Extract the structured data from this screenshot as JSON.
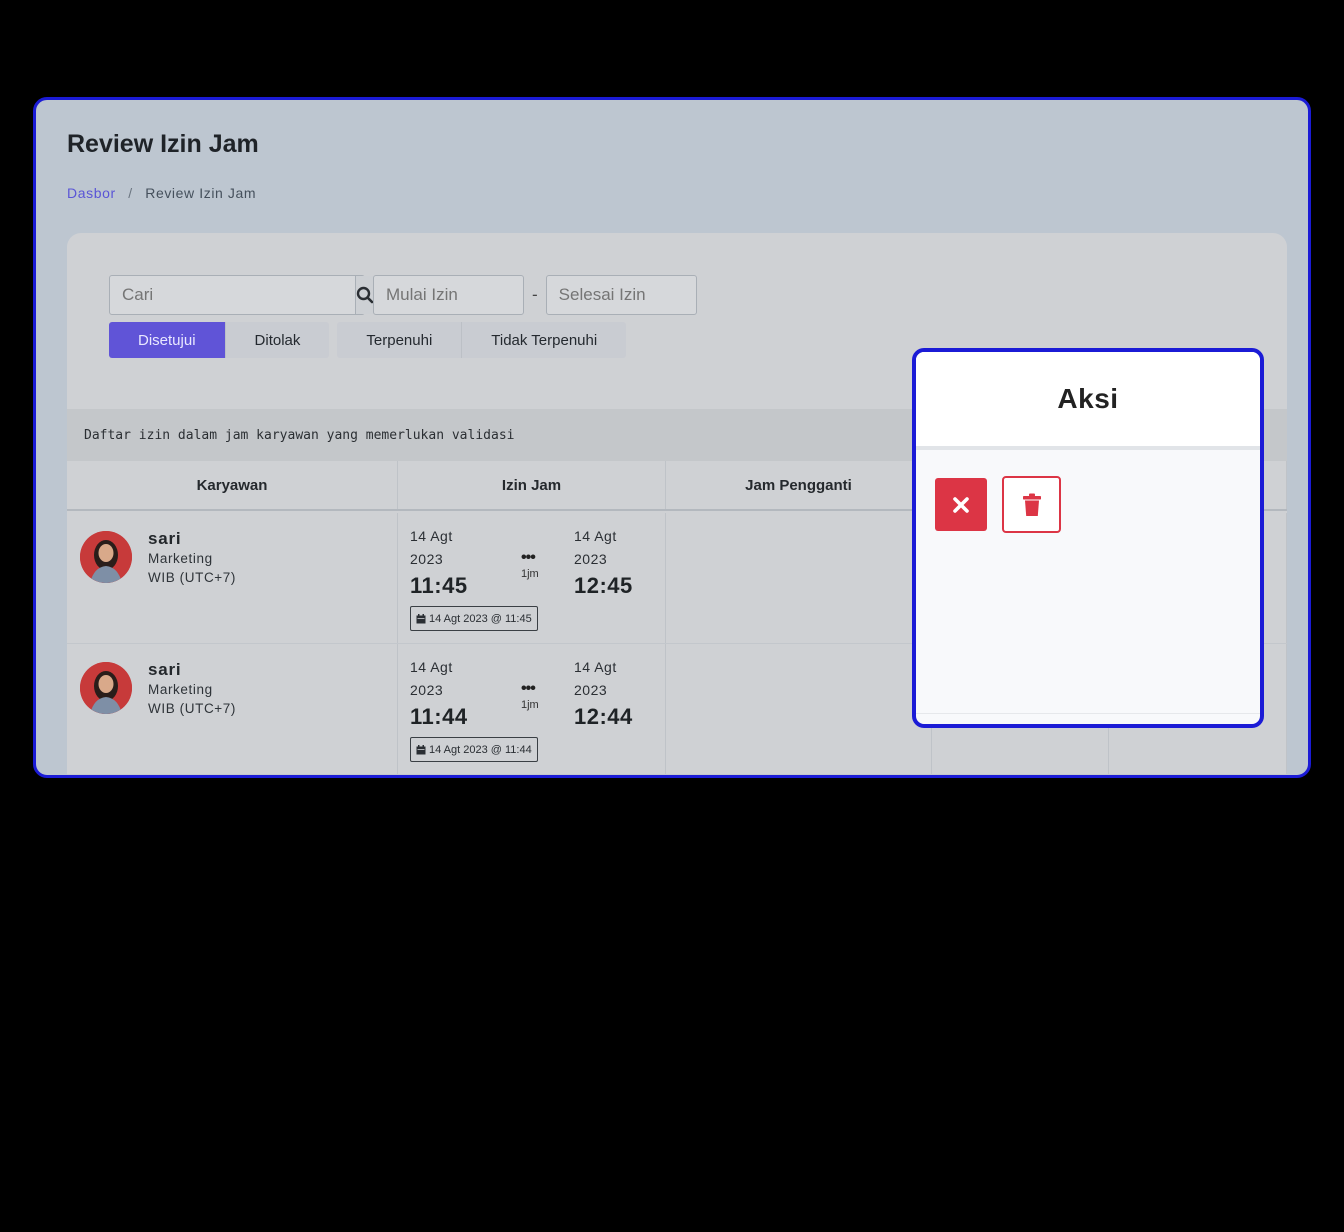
{
  "page": {
    "title": "Review Izin Jam"
  },
  "breadcrumb": {
    "home": "Dasbor",
    "separator": "/",
    "current": "Review Izin Jam"
  },
  "filters": {
    "search_placeholder": "Cari",
    "start_placeholder": "Mulai Izin",
    "range_separator": "-",
    "end_placeholder": "Selesai Izin"
  },
  "tabs": {
    "status": [
      {
        "label": "Disetujui",
        "active": true
      },
      {
        "label": "Ditolak",
        "active": false
      }
    ],
    "fulfillment": [
      {
        "label": "Terpenuhi",
        "active": false
      },
      {
        "label": "Tidak Terpenuhi",
        "active": false
      }
    ]
  },
  "table": {
    "caption": "Daftar izin dalam jam karyawan yang memerlukan validasi",
    "columns": [
      "Karyawan",
      "Izin Jam",
      "Jam Pengganti"
    ],
    "rows": [
      {
        "name": "sari",
        "department": "Marketing",
        "timezone": "WIB (UTC+7)",
        "start_date_1": "14 Agt",
        "start_date_2": "2023",
        "start_time": "11:45",
        "dots": "•••",
        "duration": "1jm",
        "end_date_1": "14 Agt",
        "end_date_2": "2023",
        "end_time": "12:45",
        "stamp": "14 Agt 2023 @ 11:45"
      },
      {
        "name": "sari",
        "department": "Marketing",
        "timezone": "WIB (UTC+7)",
        "start_date_1": "14 Agt",
        "start_date_2": "2023",
        "start_time": "11:44",
        "dots": "•••",
        "duration": "1jm",
        "end_date_1": "14 Agt",
        "end_date_2": "2023",
        "end_time": "12:44",
        "stamp": "14 Agt 2023 @ 11:44"
      }
    ]
  },
  "popup": {
    "title": "Aksi",
    "actions": [
      {
        "icon": "close-icon",
        "color": "#dc3545"
      },
      {
        "icon": "trash-icon",
        "color": "#dc3545"
      }
    ]
  },
  "colors": {
    "accent": "#6054d7",
    "danger": "#dc3545",
    "highlight_border": "#1b1bd6"
  }
}
